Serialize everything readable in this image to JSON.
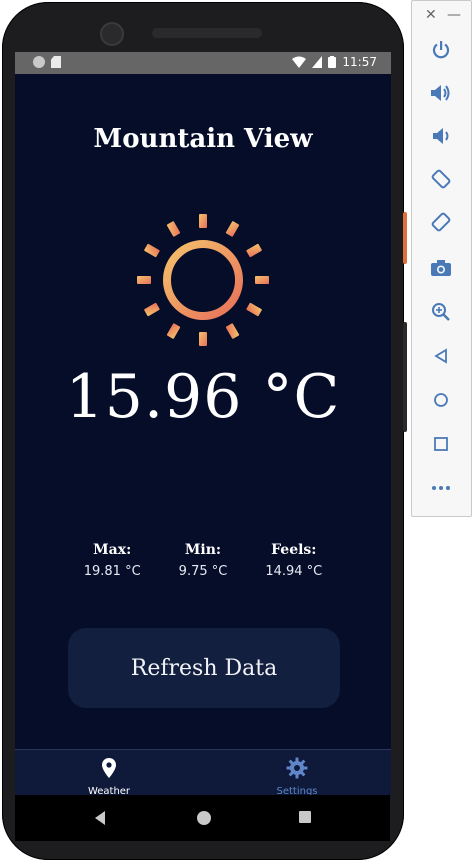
{
  "status_bar": {
    "time": "11:57"
  },
  "weather": {
    "city": "Mountain View",
    "temperature": "15.96 °C",
    "stats": [
      {
        "label": "Max:",
        "value": "19.81 °C"
      },
      {
        "label": "Min:",
        "value": "9.75 °C"
      },
      {
        "label": "Feels:",
        "value": "14.94 °C"
      }
    ],
    "refresh_label": "Refresh Data"
  },
  "bottom_nav": {
    "items": [
      {
        "label": "Weather",
        "icon": "location-pin-icon",
        "active": true
      },
      {
        "label": "Settings",
        "icon": "gear-icon",
        "active": false
      }
    ]
  },
  "colors": {
    "background": "#050d28",
    "nav_background": "#0f1a3a",
    "button_background": "#131f3f",
    "sun_gradient_start": "#f5c26b",
    "sun_gradient_end": "#e8705a",
    "settings_inactive": "#5f86c8"
  },
  "emulator_toolbar": {
    "buttons": [
      "power-icon",
      "volume-up-icon",
      "volume-down-icon",
      "rotate-left-icon",
      "rotate-right-icon",
      "camera-icon",
      "zoom-icon",
      "back-icon",
      "home-icon",
      "overview-icon",
      "more-icon"
    ]
  }
}
